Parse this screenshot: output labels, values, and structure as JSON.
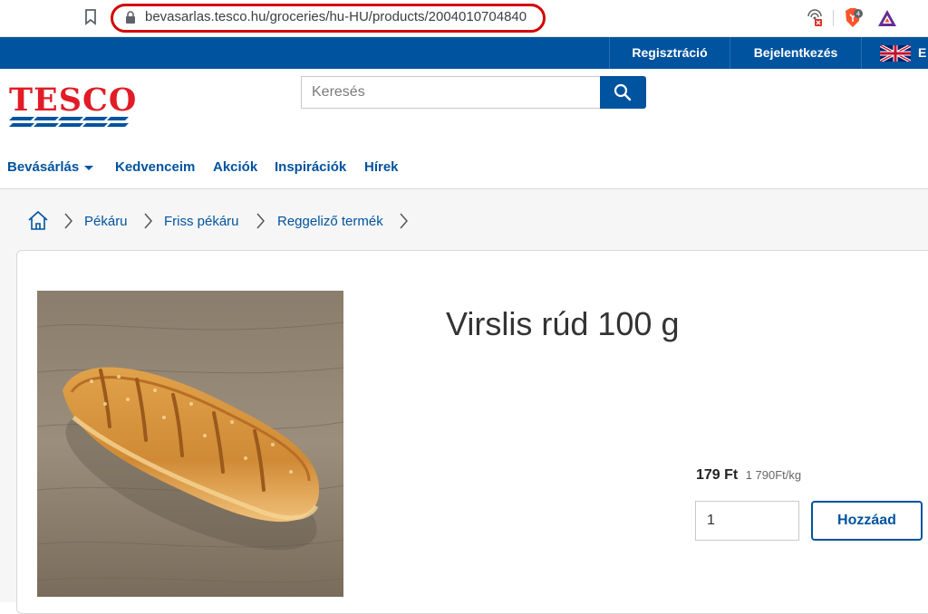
{
  "browser": {
    "url": "bevasarlas.tesco.hu/groceries/hu-HU/products/2004010704840",
    "shield_count": "4"
  },
  "utility_bar": {
    "register": "Regisztráció",
    "login": "Bejelentkezés",
    "language_letter": "E"
  },
  "header": {
    "logo": "TESCO",
    "search_placeholder": "Keresés"
  },
  "nav": {
    "items": [
      "Bevásárlás",
      "Kedvenceim",
      "Akciók",
      "Inspirációk",
      "Hírek"
    ]
  },
  "breadcrumb": [
    "Pékáru",
    "Friss pékáru",
    "Reggeliző termék"
  ],
  "product": {
    "title": "Virslis rúd 100 g",
    "price": "179 Ft",
    "unit_price": "1 790Ft/kg",
    "quantity": "1",
    "add_label": "Hozzáad"
  },
  "colors": {
    "brand_blue": "#00539f",
    "brand_red": "#e11c26"
  }
}
